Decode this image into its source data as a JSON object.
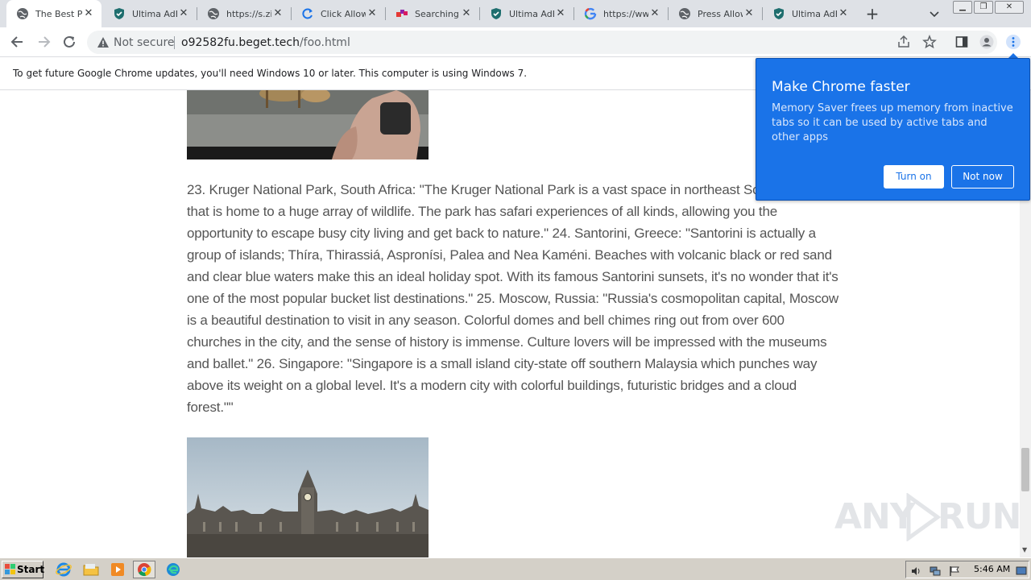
{
  "tabs": [
    {
      "title": "The Best Pl",
      "icon": "globe-icon",
      "active": true
    },
    {
      "title": "Ultima AdBl",
      "icon": "shield-icon",
      "active": false
    },
    {
      "title": "https://s.zi",
      "icon": "globe-icon",
      "active": false
    },
    {
      "title": "Click Allow",
      "icon": "refresh-icon",
      "active": false
    },
    {
      "title": "Searching f",
      "icon": "colored-squares-icon",
      "active": false
    },
    {
      "title": "Ultima AdBl",
      "icon": "shield-icon",
      "active": false
    },
    {
      "title": "https://ww",
      "icon": "google-g-icon",
      "active": false
    },
    {
      "title": "Press Allow",
      "icon": "globe-icon",
      "active": false
    },
    {
      "title": "Ultima AdBl",
      "icon": "shield-icon",
      "active": false
    }
  ],
  "address_bar": {
    "security_label": "Not secure",
    "host": "o92582fu.beget.tech",
    "path": "/foo.html"
  },
  "infobar": {
    "message": "To get future Google Chrome updates, you'll need Windows 10 or later. This computer is using Windows 7."
  },
  "article": {
    "paragraph": "23. Kruger National Park, South Africa: \"The Kruger National Park is a vast space in northeast South Africa that is home to a huge array of wildlife. The park has safari experiences of all kinds, allowing you the opportunity to escape busy city living and get back to nature.\" 24. Santorini, Greece: \"Santorini is actually a group of islands; Thíra, Thirassiá, Aspronísi, Palea and Nea Kaméni. Beaches with volcanic black or red sand and clear blue waters make this an ideal holiday spot. With its famous Santorini sunsets, it's no wonder that it's one of the most popular bucket list destinations.\" 25. Moscow, Russia: \"Russia's cosmopolitan capital, Moscow is a beautiful destination to visit in any season. Colorful domes and bell chimes ring out from over 600 churches in the city, and the sense of history is immense. Culture lovers will be impressed with the museums and ballet.\" 26. Singapore: \"Singapore is a small island city-state off southern Malaysia which punches way above its weight on a global level. It's a modern city with colorful buildings, futuristic bridges and a cloud forest.\"\""
  },
  "promo": {
    "title": "Make Chrome faster",
    "body": "Memory Saver frees up memory from inactive tabs so it can be used by active tabs and other apps",
    "primary_button": "Turn on",
    "secondary_button": "Not now"
  },
  "watermark": {
    "text_left": "ANY",
    "text_right": "RUN"
  },
  "taskbar": {
    "start_label": "Start",
    "apps": [
      "ie-icon",
      "folder-icon",
      "media-player-icon",
      "chrome-icon",
      "edge-icon"
    ],
    "clock": "5:46 AM"
  },
  "colors": {
    "accent": "#1a73e8",
    "tabstrip": "#dee1e6",
    "text_body": "#555555"
  }
}
